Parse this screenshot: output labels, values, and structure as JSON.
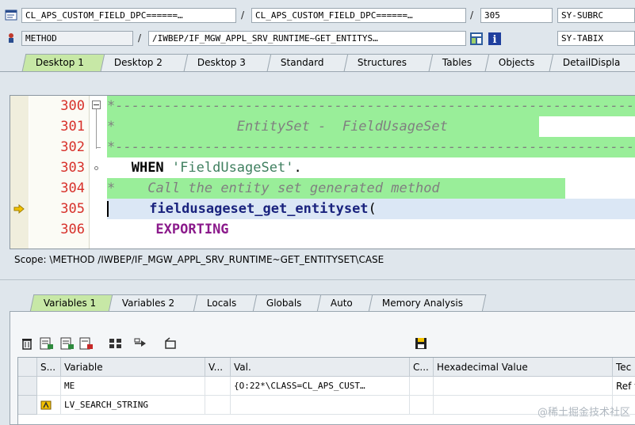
{
  "header": {
    "row1": {
      "program": "CL_APS_CUSTOM_FIELD_DPC======…",
      "include": "CL_APS_CUSTOM_FIELD_DPC======…",
      "line": "305",
      "sysfield": "SY-SUBRC"
    },
    "row2": {
      "event_type": "METHOD",
      "event_name": "/IWBEP/IF_MGW_APPL_SRV_RUNTIME~GET_ENTITYS…",
      "sysfield": "SY-TABIX"
    },
    "separator": "/"
  },
  "desktop_tabs": [
    "Desktop 1",
    "Desktop 2",
    "Desktop 3",
    "Standard",
    "Structures",
    "Tables",
    "Objects",
    "DetailDispla"
  ],
  "editor": {
    "line_numbers": [
      "300",
      "301",
      "302",
      "303",
      "304",
      "305",
      "306"
    ],
    "lines": {
      "l300": "*----------------------------------------------------------------",
      "l301_star": "*",
      "l301_text": "EntitySet -  FieldUsageSet",
      "l302": "*----------------------------------------------------------------",
      "l303_kw": "WHEN",
      "l303_str": "'FieldUsageSet'",
      "l303_end": ".",
      "l304_star": "*",
      "l304_text": "Call the entity set generated method",
      "l305_fn": "fieldusageset_get_entityset",
      "l305_paren": "(",
      "l306_kw": "EXPORTING"
    }
  },
  "scope": "Scope: \\METHOD /IWBEP/IF_MGW_APPL_SRV_RUNTIME~GET_ENTITYSET\\CASE",
  "variable_tabs": [
    "Variables 1",
    "Variables 2",
    "Locals",
    "Globals",
    "Auto",
    "Memory Analysis"
  ],
  "grid": {
    "columns": [
      "S...",
      "Variable",
      "V...",
      "Val.",
      "C...",
      "Hexadecimal Value",
      "Tec"
    ],
    "rows": [
      {
        "variable": "ME",
        "value": "{O:22*\\CLASS=CL_APS_CUST…",
        "tec": "Ref t"
      },
      {
        "variable": "LV_SEARCH_STRING",
        "value": "",
        "tec": ""
      }
    ]
  },
  "watermark": "@稀土掘金技术社区",
  "colors": {
    "active_tab": "#c7e8a6",
    "comment_bg": "#99ee99",
    "line_number": "#d7302a"
  }
}
